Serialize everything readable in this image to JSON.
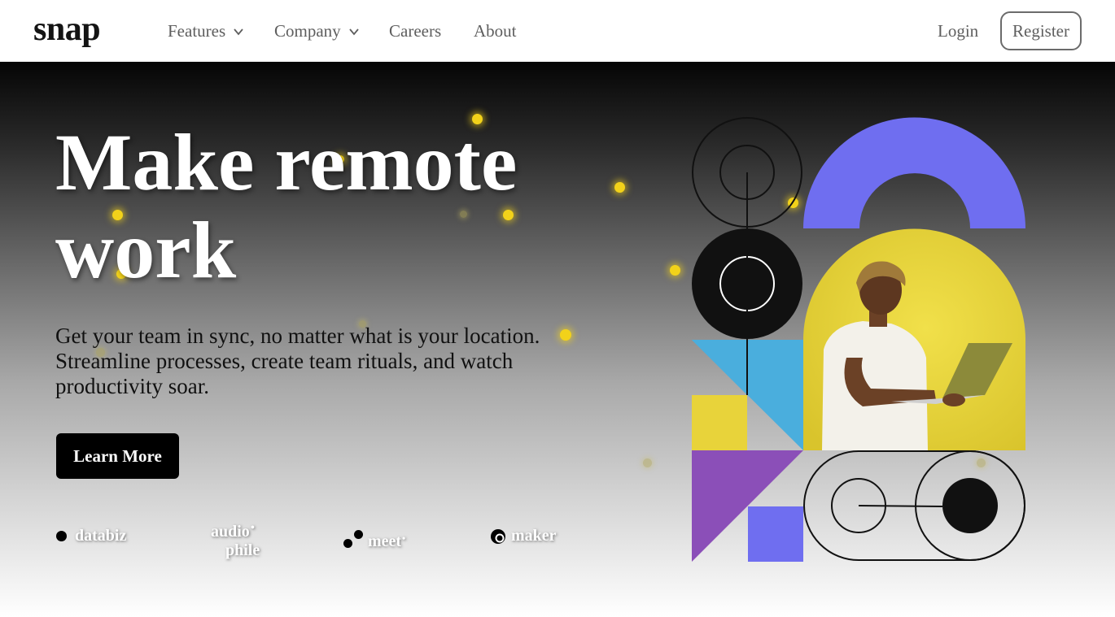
{
  "nav": {
    "logo": "snap",
    "items": [
      {
        "label": "Features",
        "has_dropdown": true
      },
      {
        "label": "Company",
        "has_dropdown": true
      },
      {
        "label": "Careers",
        "has_dropdown": false
      },
      {
        "label": "About",
        "has_dropdown": false
      }
    ],
    "login": "Login",
    "register": "Register"
  },
  "hero": {
    "headline_line1": "Make remote",
    "headline_line2": "work",
    "subtitle": "Get your team in sync, no matter what is your location. Streamline processes, create team rituals, and watch productivity soar.",
    "cta": "Learn More"
  },
  "clients": [
    {
      "name": "databiz"
    },
    {
      "name_line1": "audio",
      "name_line2": "phile"
    },
    {
      "name": "meet"
    },
    {
      "name": "maker"
    }
  ],
  "colors": {
    "accent_purple": "#6f6ef0",
    "accent_yellow": "#e8d33a",
    "accent_blue": "#4aaedd",
    "accent_violet": "#8b4fb8",
    "dot_yellow": "#f2d21a"
  },
  "icons": [
    "chevron-down-icon"
  ]
}
